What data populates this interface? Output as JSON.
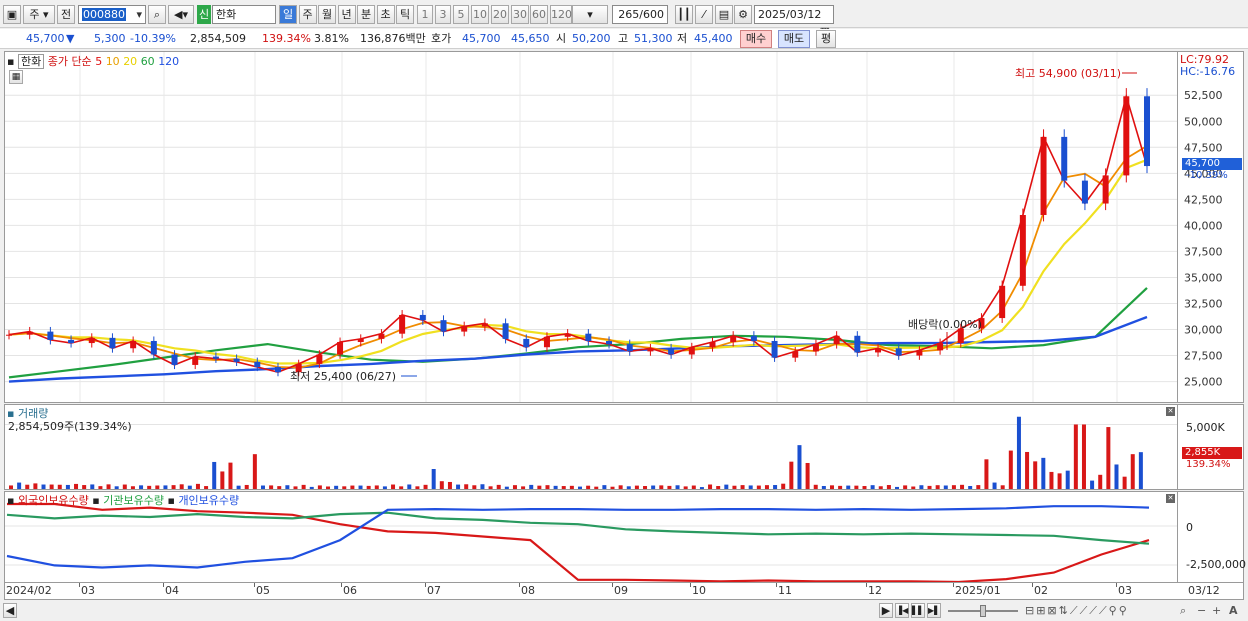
{
  "toolbar": {
    "market": "주",
    "prev": "전",
    "code": "000880",
    "name": "한화",
    "badge": "신",
    "periods": [
      "일",
      "주",
      "월",
      "년",
      "분",
      "초",
      "틱"
    ],
    "minutes": [
      "1",
      "3",
      "5",
      "10",
      "20",
      "30",
      "60",
      "120"
    ],
    "count": "265",
    "count_total": "/600",
    "date": "2025/03/12"
  },
  "quote": {
    "price": "45,700",
    "arrow": "▼",
    "change": "5,300",
    "change_pct": "-10.39%",
    "volume": "2,854,509",
    "vol_ratio": "139.34%",
    "turnover": "3.81%",
    "amount": "136,876백만",
    "ask_label": "호가",
    "ask": "45,700",
    "bid": "45,650",
    "open_label": "시",
    "open": "50,200",
    "high_label": "고",
    "high": "51,300",
    "low_label": "저",
    "low": "45,400",
    "buy": "매수",
    "sell": "매도",
    "avg": "평"
  },
  "price_panel": {
    "title": "한화",
    "legend_label": "종가 단순",
    "ma": [
      "5",
      "10",
      "20",
      "60",
      "120"
    ],
    "lc": "LC:79.92",
    "hc": "HC:-16.76",
    "high_note": "최고 54,900 (03/11)",
    "low_note": "최저 25,400 (06/27)",
    "dividend": "배당락(0.00%)",
    "cur_price": "45,700",
    "cur_pct": "-10.39%",
    "y_ticks": [
      "52,500",
      "50,000",
      "47,500",
      "45,000",
      "42,500",
      "40,000",
      "37,500",
      "35,000",
      "32,500",
      "30,000",
      "27,500",
      "25,000"
    ]
  },
  "volume_panel": {
    "title": "거래량",
    "value": "2,854,509주(139.34%)",
    "y_tick": "5,000K",
    "cur": "2,855K",
    "pct": "139.34%"
  },
  "holdings_panel": {
    "s1": "외국인보유수량",
    "s2": "기관보유수량",
    "s3": "개인보유수량",
    "ticks": [
      "0",
      "-2,500,000"
    ]
  },
  "x_axis": [
    "2024/02",
    "03",
    "04",
    "05",
    "06",
    "07",
    "08",
    "09",
    "10",
    "11",
    "12",
    "2025/01",
    "02",
    "03",
    "03/12"
  ],
  "chart_data": {
    "type": "candlestick",
    "x_labels": [
      "2024/02",
      "03",
      "04",
      "05",
      "06",
      "07",
      "08",
      "09",
      "10",
      "11",
      "12",
      "2025/01",
      "02",
      "03"
    ],
    "y_range": [
      24000,
      55500
    ],
    "close": [
      29500,
      29800,
      29000,
      28700,
      29200,
      28200,
      28900,
      27600,
      26600,
      27400,
      27200,
      26900,
      26400,
      25900,
      26700,
      27600,
      28800,
      29100,
      29600,
      31400,
      30900,
      29800,
      30300,
      30600,
      29100,
      28300,
      29300,
      29600,
      28900,
      28600,
      27900,
      28200,
      27600,
      28300,
      28800,
      29400,
      28900,
      27300,
      27900,
      28600,
      29400,
      27800,
      28200,
      27500,
      28000,
      28700,
      30100,
      31100,
      34200,
      41000,
      48500,
      44300,
      42100,
      44800,
      52400,
      45700
    ],
    "high_low": {
      "high": "54,900 (03/11)",
      "low": "25,400 (06/27)"
    },
    "ma_colors": {
      "5": "#e01010",
      "10": "#f08c00",
      "20": "#f0e020",
      "60": "#20a040",
      "120": "#2050e0"
    },
    "ma120": [
      25000,
      25300,
      25500,
      25700,
      26000,
      26200,
      26500,
      26700,
      27000,
      27200,
      27600,
      27900,
      28000,
      28200,
      28400,
      28500,
      28600,
      28700,
      28700,
      28800,
      28900,
      29300,
      31200
    ],
    "ma60": [
      25400,
      26000,
      26600,
      27300,
      28000,
      28600,
      27800,
      27100,
      26900,
      27200,
      27700,
      28300,
      28600,
      29100,
      29400,
      29300,
      29000,
      28500,
      28400,
      28200,
      28500,
      29300,
      34000
    ],
    "volume_k": [
      500,
      450,
      380,
      420,
      360,
      350,
      300,
      310,
      380,
      400,
      2100,
      340,
      320,
      300,
      320,
      280,
      260,
      300,
      290,
      350,
      330,
      650,
      400,
      380,
      320,
      300,
      330,
      280,
      260,
      300,
      290,
      280,
      310,
      300,
      270,
      350,
      330,
      320,
      420,
      3400,
      330,
      300,
      290,
      310,
      280,
      300,
      320,
      350,
      310,
      500,
      3000,
      2700,
      1500,
      1000,
      1100,
      1300,
      2855
    ],
    "holdings": {
      "foreign": [
        1,
        1,
        0.92,
        0.95,
        0.9,
        0.88,
        0.85,
        0.72,
        0.62,
        0.6,
        0.55,
        0.5,
        -0.05,
        -0.05,
        -0.06,
        -0.07,
        -0.06,
        -0.07,
        -0.07,
        -0.07,
        -0.08,
        -0.04,
        0.05,
        0.3,
        0.5
      ],
      "institution": [
        0.85,
        0.8,
        0.84,
        0.82,
        0.86,
        0.82,
        0.8,
        0.86,
        0.88,
        0.8,
        0.78,
        0.74,
        0.72,
        0.65,
        0.62,
        0.6,
        0.58,
        0.59,
        0.58,
        0.59,
        0.58,
        0.57,
        0.56,
        0.5,
        0.45
      ],
      "individual": [
        0.28,
        0.15,
        0.12,
        0.15,
        0.12,
        0.2,
        0.25,
        0.5,
        0.92,
        0.93,
        0.92,
        0.93,
        0.93,
        0.92,
        0.92,
        0.93,
        0.93,
        0.92,
        0.93,
        0.92,
        0.93,
        0.94,
        0.97,
        0.97,
        0.95
      ]
    }
  }
}
